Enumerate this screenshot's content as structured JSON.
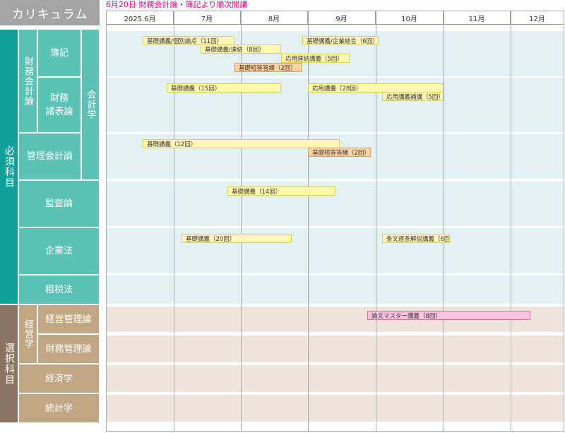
{
  "header": {
    "title": "カリキュラム",
    "notice": "6月20日 財務会計論・簿記より順次開講"
  },
  "months": [
    "2025.6月",
    "7月",
    "8月",
    "9月",
    "10月",
    "11月",
    "12月"
  ],
  "sidebar": {
    "required": "必須科目",
    "elective": "選択科目",
    "zaimu_kaikei_ron": "財務会計論",
    "kaikeigaku": "会計学",
    "keieigaku": "経営学",
    "boki": "簿記",
    "zaimu_shohyo_ron": "財務\n諸表論",
    "kanri_kaikei_ron": "管理会計論",
    "kansa_ron": "監査論",
    "kigyo_ho": "企業法",
    "sozei_ho": "租税法",
    "keiei_kanri_ron": "経営管理論",
    "zaimu_kanri_ron": "財務管理論",
    "keizaigaku": "経済学",
    "tokeigaku": "統計学"
  },
  "bars": {
    "boki_kiso": "基礎講義/個別論点（11回）",
    "boki_renketsu": "基礎講義/連結（8回）",
    "boki_tanto": "基礎短答答練（2回）",
    "boki_kigyo_ketsugo": "基礎講義/企業結合（6回）",
    "boki_oyo_renketsu": "応用連結講義（5回）",
    "shohyo_kiso": "基礎講義（15回）",
    "shohyo_oyo": "応用講義（28回）",
    "shohyo_hoho": "応用講義補講（5回）",
    "kanri_kiso": "基礎講義（12回）",
    "kanri_tanto": "基礎短答答練（2回）",
    "kansa_kiso": "基礎講義（14回）",
    "kigyo_kiso": "基礎講義（20回）",
    "kigyo_jobun": "条文逐条解説講義（6回）",
    "keiei_ronbun": "論文マスター講義（8回）"
  },
  "colors": {
    "required_primary": "#10a09a",
    "required_secondary": "#5cc2b6",
    "elective_primary": "#8c7560",
    "elective_secondary": "#c1a683",
    "notice": "#e3007f",
    "bar_lecture": "#fff7b3",
    "bar_drill": "#fcd6a9",
    "bar_master": "#f8c6dd"
  }
}
